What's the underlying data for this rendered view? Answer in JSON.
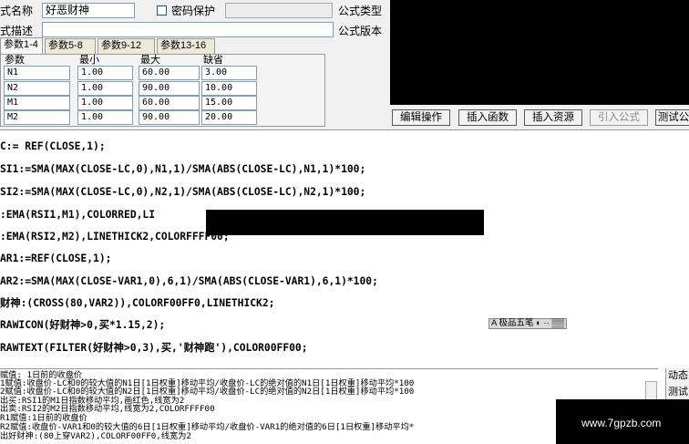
{
  "form": {
    "name_label": "式名称",
    "name_value": "好恶财神",
    "password_label": "密码保护",
    "desc_label": "式描述",
    "type_label": "公式类型",
    "version_label": "公式版本"
  },
  "tabs": [
    "参数1-4",
    "参数5-8",
    "参数9-12",
    "参数13-16"
  ],
  "params": {
    "headers": [
      "参数",
      "最小",
      "最大",
      "缺省"
    ],
    "rows": [
      [
        "N1",
        "1.00",
        "60.00",
        "3.00"
      ],
      [
        "N2",
        "1.00",
        "90.00",
        "10.00"
      ],
      [
        "M1",
        "1.00",
        "60.00",
        "15.00"
      ],
      [
        "M2",
        "1.00",
        "90.00",
        "20.00"
      ]
    ]
  },
  "buttons": [
    "编辑操作",
    "插入函数",
    "插入资源",
    "引入公式",
    "测试公"
  ],
  "code": [
    "C:= REF(CLOSE,1);",
    "SI1:=SMA(MAX(CLOSE-LC,0),N1,1)/SMA(ABS(CLOSE-LC),N1,1)*100;",
    "SI2:=SMA(MAX(CLOSE-LC,0),N2,1)/SMA(ABS(CLOSE-LC),N2,1)*100;",
    ":EMA(RSI1,M1),COLORRED,LI",
    ":EMA(RSI2,M2),LINETHICK2,COLORFFFF00;",
    "AR1:=REF(CLOSE,1);",
    "AR2:=SMA(MAX(CLOSE-VAR1,0),6,1)/SMA(ABS(CLOSE-VAR1),6,1)*100;",
    "财神:(CROSS(80,VAR2)),COLORF00FF0,LINETHICK2;",
    "RAWICON(好财神>0,买*1.15,2);",
    "RAWTEXT(FILTER(好财神>0,3),买,'财神跑'),COLOR00FF00;"
  ],
  "ime": "A 极品五笔 ◐ ·· ▒▒",
  "messages": [
    "赋值: 1日前的收盘价",
    "1赋值:收盘价-LC和0的较大值的N1日[1日权重]移动平均/收盘价-LC的绝对值的N1日[1日权重]移动平均*100",
    "2赋值:收盘价-LC和0的较大值的N2日[1日权重]移动平均/收盘价-LC的绝对值的N2日[1日权重]移动平均*100",
    "出买:RSI1的M1日指数移动平均,画红色,线宽为2",
    "出卖:RSI2的M2日指数移动平均,线宽为2,COLORFFFF00",
    "R1赋值:1日前的收盘价",
    "R2赋值:收盘价-VAR1和0的较大值的6日[1日权重]移动平均/收盘价-VAR1的绝对值的6日[1日权重]移动平均*",
    "出好财神:(80上穿VAR2),COLORF00FF0,线宽为2"
  ],
  "side_buttons": [
    "动态",
    "测试"
  ],
  "watermark": "www.7gpzb.com"
}
